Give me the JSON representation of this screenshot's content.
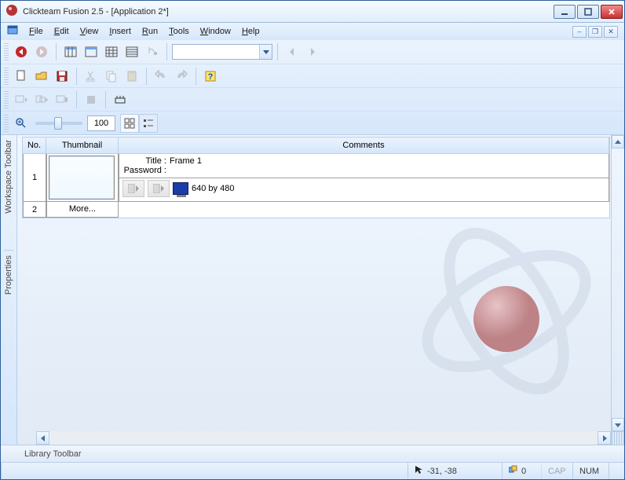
{
  "title": "Clickteam Fusion 2.5 - [Application 2*]",
  "menu": {
    "file": "File",
    "edit": "Edit",
    "view": "View",
    "insert": "Insert",
    "run": "Run",
    "tools": "Tools",
    "window": "Window",
    "help": "Help"
  },
  "zoom": {
    "value": "100"
  },
  "sidebar": {
    "workspace": "Workspace Toolbar",
    "properties": "Properties"
  },
  "storyboard": {
    "headers": {
      "no": "No.",
      "thumb": "Thumbnail",
      "comments": "Comments"
    },
    "row1": {
      "no": "1",
      "title_k": "Title :",
      "title_v": "Frame 1",
      "pwd_k": "Password :",
      "pwd_v": "",
      "size": "640 by 480"
    },
    "row2": {
      "no": "2",
      "more": "More..."
    }
  },
  "library_tab": "Library Toolbar",
  "status": {
    "coords": "-31, -38",
    "objcount": "0",
    "cap": "CAP",
    "num": "NUM"
  }
}
